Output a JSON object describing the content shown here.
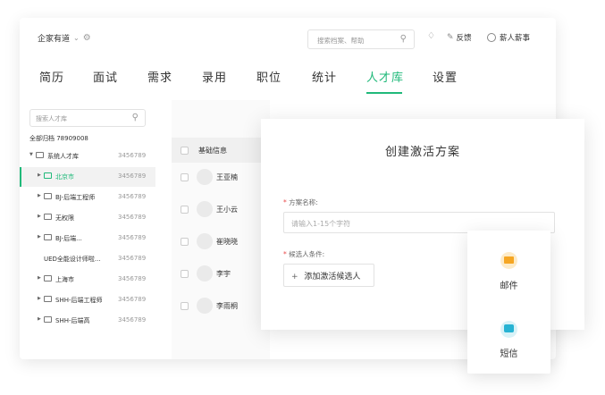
{
  "header": {
    "company": "企家有道",
    "search_placeholder": "搜索档案、帮助",
    "feedback": "反馈",
    "user": "薪人薪事"
  },
  "nav": {
    "tabs": [
      "简历",
      "面试",
      "需求",
      "录用",
      "职位",
      "统计",
      "人才库",
      "设置"
    ],
    "active": "人才库"
  },
  "sidebar": {
    "search_placeholder": "搜索人才库",
    "all_label": "全部归档 78909008",
    "items": [
      {
        "name": "系统人才库",
        "count": "3456789"
      },
      {
        "name": "北京市",
        "count": "3456789"
      },
      {
        "name": "BJ-后端工程师",
        "count": "3456789"
      },
      {
        "name": "无权限",
        "count": "3456789"
      },
      {
        "name": "BJ-后端...",
        "count": "3456789"
      },
      {
        "name": "UED全能设计师啦...",
        "count": "3456789"
      },
      {
        "name": "上海市",
        "count": "3456789"
      },
      {
        "name": "SHH-后端工程师",
        "count": "3456789"
      },
      {
        "name": "SHH-后端高",
        "count": "3456789"
      }
    ]
  },
  "list": {
    "header": "基础信息",
    "rows": [
      "王亚楠",
      "王小云",
      "崔晓晓",
      "李宇",
      "李雨桐"
    ]
  },
  "panel": {
    "title": "创建激活方案",
    "name_label": "方案名称:",
    "name_placeholder": "请输入1-15个字符",
    "cond_label": "候选人条件:",
    "add_button": "添加激活候选人"
  },
  "channels": {
    "mail": "邮件",
    "sms": "短信"
  },
  "colors": {
    "accent": "#20b97a",
    "mail_icon": "#f5a623",
    "sms_icon": "#27b3d3"
  }
}
